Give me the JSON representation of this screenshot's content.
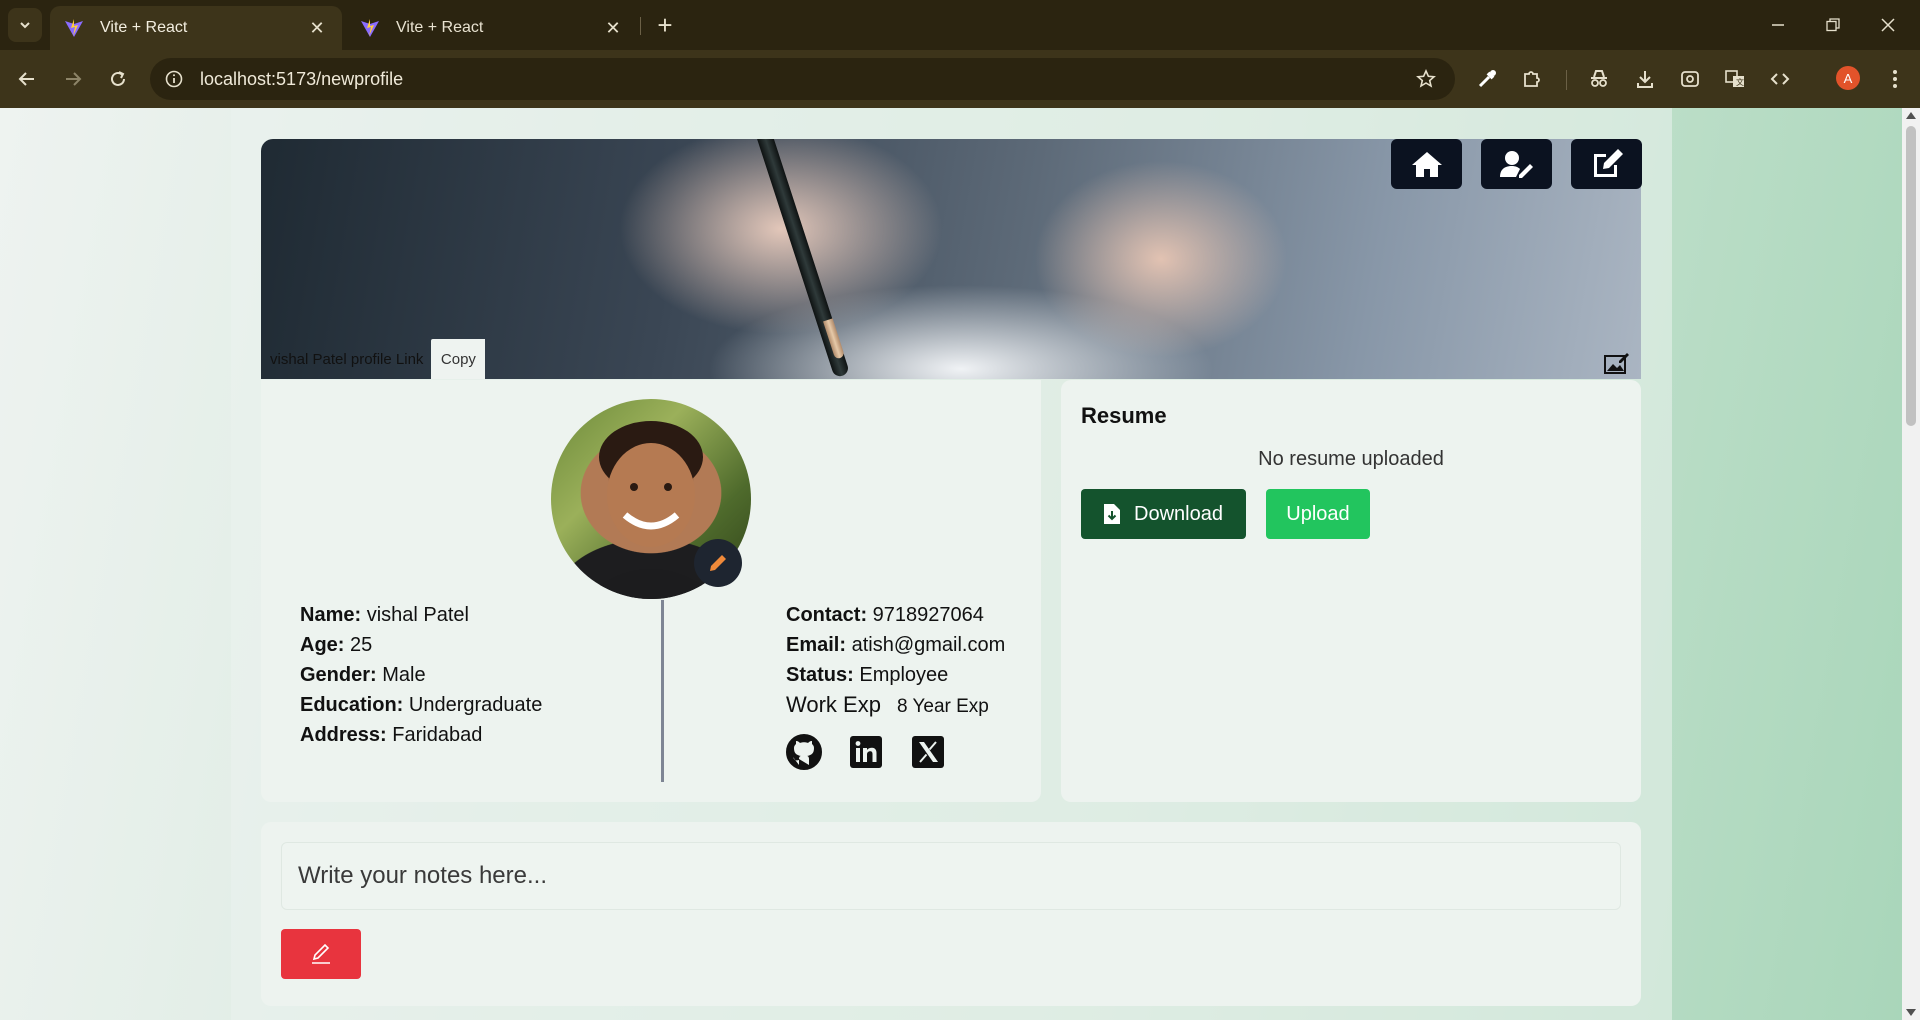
{
  "browser": {
    "tabs": [
      {
        "title": "Vite + React",
        "active": true
      },
      {
        "title": "Vite + React",
        "active": false
      }
    ],
    "url": "localhost:5173/newprofile",
    "profile_initial": "A",
    "accent_color": "#e2532a"
  },
  "cover": {
    "profile_link_label": "vishal Patel profile Link",
    "copy_label": "Copy",
    "actions": [
      "home-icon",
      "user-edit-icon",
      "edit-icon"
    ]
  },
  "profile": {
    "left_fields": [
      {
        "label": "Name:",
        "value": "vishal Patel"
      },
      {
        "label": "Age:",
        "value": "25"
      },
      {
        "label": "Gender:",
        "value": "Male"
      },
      {
        "label": "Education:",
        "value": "Undergraduate"
      },
      {
        "label": "Address:",
        "value": "Faridabad"
      }
    ],
    "right_fields": [
      {
        "label": "Contact:",
        "value": "9718927064"
      },
      {
        "label": "Email:",
        "value": "atish@gmail.com"
      },
      {
        "label": "Status:",
        "value": "Employee"
      }
    ],
    "work_exp_label": "Work Exp",
    "work_exp_value": "8 Year Exp",
    "socials": [
      "github-icon",
      "linkedin-icon",
      "x-twitter-icon"
    ]
  },
  "resume": {
    "title": "Resume",
    "empty_text": "No resume uploaded",
    "download_label": "Download",
    "upload_label": "Upload",
    "download_color": "#14532d",
    "upload_color": "#22c55e"
  },
  "notes": {
    "placeholder": "Write your notes here...",
    "save_color": "#e8343e"
  }
}
